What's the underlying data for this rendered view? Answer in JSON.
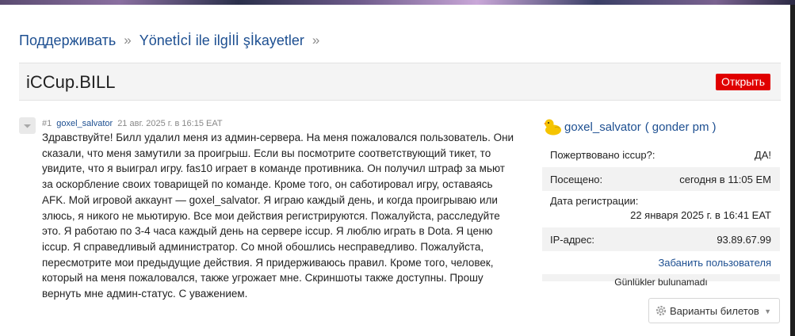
{
  "breadcrumb": {
    "items": [
      "Поддерживать",
      "Yönetİcİ ile ilgİlİ şİkayetler"
    ],
    "separator": "»"
  },
  "thread": {
    "title": "iCCup.BILL",
    "open_label": "Открыть"
  },
  "post": {
    "number": "#1",
    "author": "goxel_salvator",
    "date": "21 авг. 2025 г. в 16:15 EAT",
    "body": "Здравствуйте! Билл удалил меня из админ-сервера. На меня пожаловался пользователь. Они сказали, что меня замутили за проигрыш. Если вы посмотрите соответствующий тикет, то увидите, что я выиграл игру. fas10 играет в команде противника. Он получил штраф за мьют за оскорбление своих товарищей по команде. Кроме того, он саботировал игру, оставаясь AFK. Мой игровой аккаунт — goxel_salvator. Я играю каждый день, и когда проигрываю или злюсь, я никого не мьютирую. Все мои действия регистрируются. Пожалуйста, расследуйте это. Я работаю по 3-4 часа каждый день на сервере iccup. Я люблю играть в Dota. Я ценю iccup. Я справедливый администратор. Со мной обошлись несправедливо. Пожалуйста, пересмотрите мои предыдущие действия. Я придерживаюсь правил. Кроме того, человек, который на меня пожаловался, также угрожает мне. Скриншоты также доступны. Прошу вернуть мне админ-статус. С уважением."
  },
  "profile": {
    "name": "goxel_salvator",
    "pm_prefix": "(",
    "pm_label": "gonder pm",
    "pm_suffix": ")",
    "rows": [
      {
        "label": "Пожертвовано iccup?:",
        "value": "ДА!"
      },
      {
        "label": "Посещено:",
        "value": "сегодня в 11:05 EM"
      },
      {
        "label": "Дата регистрации:",
        "value": "22 января 2025 г. в 16:41 EAT"
      },
      {
        "label": "IP-адрес:",
        "value": "93.89.67.99"
      }
    ],
    "ban_label": "Забанить пользователя",
    "logs_label": "Günlükler bulunamadı",
    "ticket_options_label": "Варианты билетов"
  },
  "colors": {
    "link": "#1d4f91",
    "open_button": "#e00000",
    "row_alt": "#f2f2f2"
  },
  "icons": [
    "duck-avatar-icon",
    "gear-icon",
    "chevron-down-icon",
    "post-vote-icon"
  ]
}
